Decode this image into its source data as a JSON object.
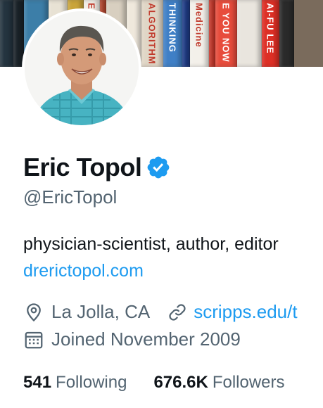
{
  "banner": {
    "books": [
      {
        "color": "#24343f",
        "text": "",
        "w": 18
      },
      {
        "color": "#1a2228",
        "text": "",
        "w": 14
      },
      {
        "color": "#3c7ea8",
        "text": "",
        "w": 34
      },
      {
        "color": "#e8e2d4",
        "text": "",
        "w": 26
      },
      {
        "color": "#c9a43a",
        "text": "",
        "w": 22
      },
      {
        "color": "#f2eee6",
        "text": "ES",
        "w": 22
      },
      {
        "color": "#b8472f",
        "text": "",
        "w": 8
      },
      {
        "color": "#d8cfc0",
        "text": "",
        "w": 28
      },
      {
        "color": "#efe8dc",
        "text": "",
        "w": 20
      },
      {
        "color": "#e0d6c6",
        "text": "ALGORITHM",
        "w": 30
      },
      {
        "color": "#3f7fc6",
        "text": "THINKING",
        "w": 26
      },
      {
        "color": "#1f3c88",
        "text": "",
        "w": 10
      },
      {
        "color": "#f3f0ea",
        "text": "Medicine",
        "w": 26
      },
      {
        "color": "#cf3a2c",
        "text": "",
        "w": 8
      },
      {
        "color": "#e74c3c",
        "text": "E YOU NOW",
        "w": 30
      },
      {
        "color": "#e9e5de",
        "text": "",
        "w": 34
      },
      {
        "color": "#dd2f25",
        "text": "AI-FU LEE",
        "w": 24
      },
      {
        "color": "#2a2a2a",
        "text": "",
        "w": 20
      }
    ]
  },
  "profile": {
    "name": "Eric Topol",
    "handle": "@EricTopol",
    "bio": "physician-scientist, author, editor",
    "bio_link": "drerictopol.com",
    "location": "La Jolla, CA",
    "website": "scripps.edu/t",
    "joined": "Joined November 2009",
    "following_count": "541",
    "following_label": "Following",
    "followers_count": "676.6K",
    "followers_label": "Followers"
  },
  "colors": {
    "accent": "#1d9bf0",
    "secondary_text": "#536471",
    "primary_text": "#0f1419"
  },
  "icons": {
    "verified": "verified-badge-icon",
    "location": "location-pin-icon",
    "link": "link-icon",
    "calendar": "calendar-icon"
  }
}
